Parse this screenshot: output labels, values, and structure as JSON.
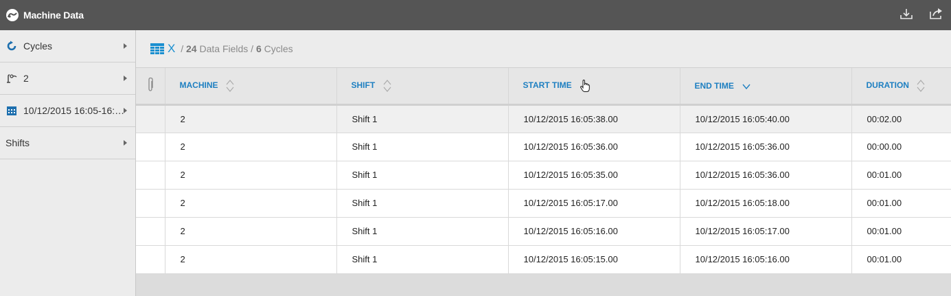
{
  "app": {
    "title": "Machine Data",
    "icons": {
      "logo": "gauge-logo",
      "download": "download-icon",
      "share": "share-icon"
    }
  },
  "sidebar": {
    "items": [
      {
        "label": "Cycles",
        "icon": "cycle-icon"
      },
      {
        "label": "2",
        "icon": "machine-icon"
      },
      {
        "label": "10/12/2015  16:05-16:…",
        "icon": "calendar-icon"
      },
      {
        "label": "Shifts",
        "icon": ""
      }
    ]
  },
  "breadcrumb": {
    "root": "X",
    "sep1": " / ",
    "fields_count": "24",
    "fields_label": " Data Fields / ",
    "cycles_count": "6",
    "cycles_label": " Cycles"
  },
  "table": {
    "columns": [
      "MACHINE",
      "SHIFT",
      "START TIME",
      "END TIME",
      "DURATION"
    ],
    "sort": {
      "END TIME": "descending"
    },
    "rows": [
      [
        "2",
        "Shift 1",
        "10/12/2015 16:05:38.00",
        "10/12/2015 16:05:40.00",
        "00:02.00"
      ],
      [
        "2",
        "Shift 1",
        "10/12/2015 16:05:36.00",
        "10/12/2015 16:05:36.00",
        "00:00.00"
      ],
      [
        "2",
        "Shift 1",
        "10/12/2015 16:05:35.00",
        "10/12/2015 16:05:36.00",
        "00:01.00"
      ],
      [
        "2",
        "Shift 1",
        "10/12/2015 16:05:17.00",
        "10/12/2015 16:05:18.00",
        "00:01.00"
      ],
      [
        "2",
        "Shift 1",
        "10/12/2015 16:05:16.00",
        "10/12/2015 16:05:17.00",
        "00:01.00"
      ],
      [
        "2",
        "Shift 1",
        "10/12/2015 16:05:15.00",
        "10/12/2015 16:05:16.00",
        "00:01.00"
      ]
    ]
  },
  "colors": {
    "topbar": "#555555",
    "accent": "#1a8fd0",
    "header_text": "#1d7fc1"
  }
}
